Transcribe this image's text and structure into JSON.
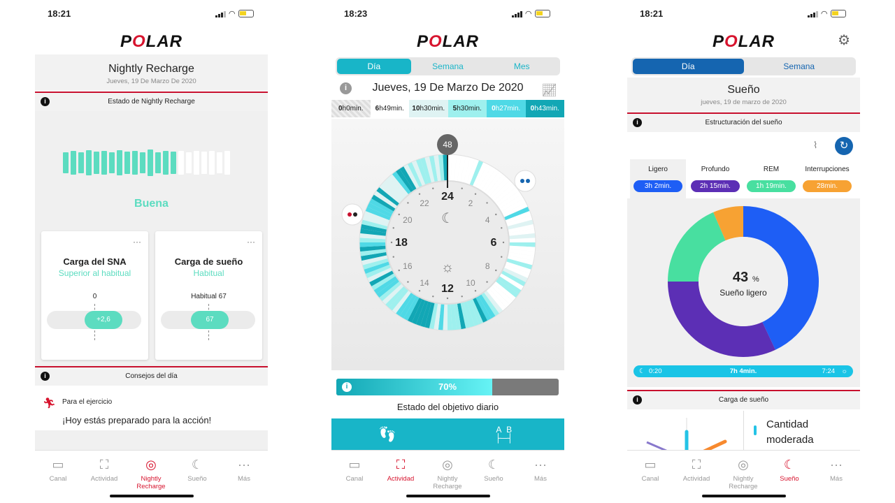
{
  "brand": "POLAR",
  "screen1": {
    "time": "18:21",
    "title": "Nightly Recharge",
    "date": "Jueves, 19 De Marzo De 2020",
    "status_section": "Estado de Nightly Recharge",
    "rating": "Buena",
    "filled_bars_fraction": 0.68,
    "card1": {
      "title": "Carga del SNA",
      "subtitle": "Superior al habitual",
      "reference": "0",
      "value": "+2,6"
    },
    "card2": {
      "title": "Carga de sueño",
      "subtitle": "Habitual",
      "reference": "Habitual 67",
      "value": "67"
    },
    "tips_section": "Consejos del día",
    "tip_category": "Para el ejercicio",
    "tip_message": "¡Hoy estás preparado para la acción!",
    "active_tab": "Nightly Recharge"
  },
  "screen2": {
    "time": "18:23",
    "segments": [
      "Día",
      "Semana",
      "Mes"
    ],
    "selected_segment": "Día",
    "date": "Jueves, 19 De Marzo De 2020",
    "intensity_prefix": [
      "0",
      "6",
      "10",
      "5",
      "0",
      "0"
    ],
    "intensity_suffix": [
      "h0min.",
      "h49min.",
      "h30min.",
      "h30min.",
      "h27min.",
      "h43min."
    ],
    "intensity_colors": [
      "#e5e5e5",
      "#ffffff",
      "#dff3f3",
      "#9ef0ee",
      "#4fd9e6",
      "#12a7b5"
    ],
    "clock": {
      "top_value": "48",
      "hours": [
        "24",
        "2",
        "4",
        "6",
        "8",
        "10",
        "12",
        "14",
        "16",
        "18",
        "20",
        "22"
      ]
    },
    "goal_percent": 70,
    "goal_label": "70%",
    "goal_text": "Estado del objetivo diario",
    "ab_labels": [
      "A",
      "B"
    ],
    "active_tab": "Actividad"
  },
  "screen3": {
    "time": "18:21",
    "segments": [
      "Día",
      "Semana"
    ],
    "selected_segment": "Día",
    "title": "Sueño",
    "date": "jueves, 19 de marzo de 2020",
    "structure_section": "Estructuración del sueño",
    "stages": [
      {
        "name": "Ligero",
        "value": "3h 2min.",
        "color": "#1e5ef5"
      },
      {
        "name": "Profundo",
        "value": "2h 15min.",
        "color": "#5c2fb5"
      },
      {
        "name": "REM",
        "value": "1h 19min.",
        "color": "#48dfa0"
      },
      {
        "name": "Interrupciones",
        "value": "28min.",
        "color": "#f7a233"
      }
    ],
    "donut_percent": "43",
    "donut_unit": "%",
    "donut_label": "Sueño ligero",
    "donut_slices": [
      {
        "name": "Ligero",
        "fraction": 0.43,
        "color": "#1e5ef5"
      },
      {
        "name": "Profundo",
        "fraction": 0.32,
        "color": "#5c2fb5"
      },
      {
        "name": "REM",
        "fraction": 0.185,
        "color": "#48dfa0"
      },
      {
        "name": "Interrupciones",
        "fraction": 0.065,
        "color": "#f7a233"
      }
    ],
    "sleep_start": "0:20",
    "sleep_total": "7h 4min.",
    "sleep_end": "7:24",
    "load_section": "Carga de sueño",
    "load_text_1": "Cantidad",
    "load_text_2": "moderada",
    "active_tab": "Sueño"
  },
  "tabs": [
    "Canal",
    "Actividad",
    "Nightly Recharge",
    "Sueño",
    "Más"
  ],
  "accent": "#d7142e",
  "teal": "#18b5c8"
}
